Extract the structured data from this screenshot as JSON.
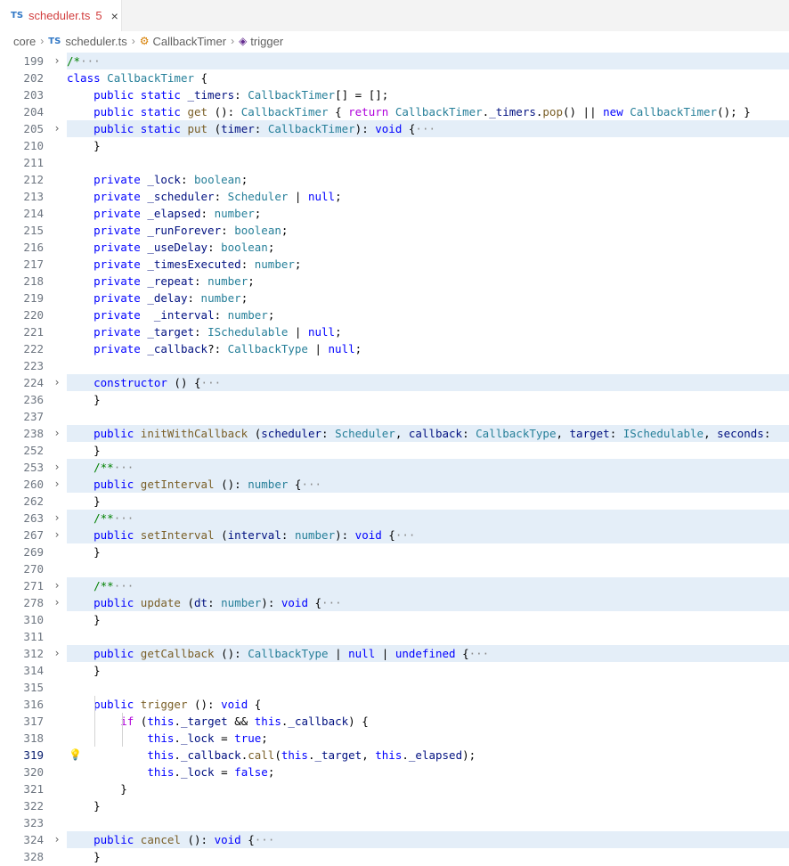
{
  "tab": {
    "icon": "TS",
    "filename": "scheduler.ts",
    "problems": "5",
    "close": "×"
  },
  "breadcrumb": {
    "folder": "core",
    "file_icon": "TS",
    "file": "scheduler.ts",
    "class_name": "CallbackTimer",
    "method": "trigger"
  },
  "lines": [
    {
      "n": "199",
      "fold": true,
      "hl": true,
      "tokens": [
        [
          "cm",
          "/*"
        ],
        [
          "dots",
          "···"
        ]
      ]
    },
    {
      "n": "202",
      "tokens": [
        [
          "kw",
          "class"
        ],
        [
          "",
          " "
        ],
        [
          "ty",
          "CallbackTimer"
        ],
        [
          "",
          " {"
        ]
      ]
    },
    {
      "n": "203",
      "tokens": [
        [
          "",
          "    "
        ],
        [
          "kw",
          "public"
        ],
        [
          "",
          " "
        ],
        [
          "kw",
          "static"
        ],
        [
          "",
          " "
        ],
        [
          "pa",
          "_timers"
        ],
        [
          "",
          ": "
        ],
        [
          "ty",
          "CallbackTimer"
        ],
        [
          "",
          "[] = [];"
        ]
      ]
    },
    {
      "n": "204",
      "tokens": [
        [
          "",
          "    "
        ],
        [
          "kw",
          "public"
        ],
        [
          "",
          " "
        ],
        [
          "kw",
          "static"
        ],
        [
          "",
          " "
        ],
        [
          "fn",
          "get"
        ],
        [
          "",
          " (): "
        ],
        [
          "ty",
          "CallbackTimer"
        ],
        [
          "",
          " { "
        ],
        [
          "ctl",
          "return"
        ],
        [
          "",
          " "
        ],
        [
          "ty",
          "CallbackTimer"
        ],
        [
          "",
          "."
        ],
        [
          "pa",
          "_timers"
        ],
        [
          "",
          "."
        ],
        [
          "fn",
          "pop"
        ],
        [
          "",
          "() || "
        ],
        [
          "kw",
          "new"
        ],
        [
          "",
          " "
        ],
        [
          "ty",
          "CallbackTimer"
        ],
        [
          "",
          "(); }"
        ]
      ]
    },
    {
      "n": "205",
      "fold": true,
      "hl": true,
      "tokens": [
        [
          "",
          "    "
        ],
        [
          "kw",
          "public"
        ],
        [
          "",
          " "
        ],
        [
          "kw",
          "static"
        ],
        [
          "",
          " "
        ],
        [
          "fn",
          "put"
        ],
        [
          "",
          " ("
        ],
        [
          "pa",
          "timer"
        ],
        [
          "",
          ": "
        ],
        [
          "ty",
          "CallbackTimer"
        ],
        [
          "",
          "): "
        ],
        [
          "kw",
          "void"
        ],
        [
          "",
          " {"
        ],
        [
          "dots",
          "···"
        ]
      ]
    },
    {
      "n": "210",
      "tokens": [
        [
          "",
          "    }"
        ]
      ]
    },
    {
      "n": "211",
      "tokens": []
    },
    {
      "n": "212",
      "tokens": [
        [
          "",
          "    "
        ],
        [
          "kw",
          "private"
        ],
        [
          "",
          " "
        ],
        [
          "pa",
          "_lock"
        ],
        [
          "",
          ": "
        ],
        [
          "ty",
          "boolean"
        ],
        [
          "",
          ";"
        ]
      ]
    },
    {
      "n": "213",
      "tokens": [
        [
          "",
          "    "
        ],
        [
          "kw",
          "private"
        ],
        [
          "",
          " "
        ],
        [
          "pa",
          "_scheduler"
        ],
        [
          "",
          ": "
        ],
        [
          "ty",
          "Scheduler"
        ],
        [
          "",
          " | "
        ],
        [
          "kw",
          "null"
        ],
        [
          "",
          ";"
        ]
      ]
    },
    {
      "n": "214",
      "tokens": [
        [
          "",
          "    "
        ],
        [
          "kw",
          "private"
        ],
        [
          "",
          " "
        ],
        [
          "pa",
          "_elapsed"
        ],
        [
          "",
          ": "
        ],
        [
          "ty",
          "number"
        ],
        [
          "",
          ";"
        ]
      ]
    },
    {
      "n": "215",
      "tokens": [
        [
          "",
          "    "
        ],
        [
          "kw",
          "private"
        ],
        [
          "",
          " "
        ],
        [
          "pa",
          "_runForever"
        ],
        [
          "",
          ": "
        ],
        [
          "ty",
          "boolean"
        ],
        [
          "",
          ";"
        ]
      ]
    },
    {
      "n": "216",
      "tokens": [
        [
          "",
          "    "
        ],
        [
          "kw",
          "private"
        ],
        [
          "",
          " "
        ],
        [
          "pa",
          "_useDelay"
        ],
        [
          "",
          ": "
        ],
        [
          "ty",
          "boolean"
        ],
        [
          "",
          ";"
        ]
      ]
    },
    {
      "n": "217",
      "tokens": [
        [
          "",
          "    "
        ],
        [
          "kw",
          "private"
        ],
        [
          "",
          " "
        ],
        [
          "pa",
          "_timesExecuted"
        ],
        [
          "",
          ": "
        ],
        [
          "ty",
          "number"
        ],
        [
          "",
          ";"
        ]
      ]
    },
    {
      "n": "218",
      "tokens": [
        [
          "",
          "    "
        ],
        [
          "kw",
          "private"
        ],
        [
          "",
          " "
        ],
        [
          "pa",
          "_repeat"
        ],
        [
          "",
          ": "
        ],
        [
          "ty",
          "number"
        ],
        [
          "",
          ";"
        ]
      ]
    },
    {
      "n": "219",
      "tokens": [
        [
          "",
          "    "
        ],
        [
          "kw",
          "private"
        ],
        [
          "",
          " "
        ],
        [
          "pa",
          "_delay"
        ],
        [
          "",
          ": "
        ],
        [
          "ty",
          "number"
        ],
        [
          "",
          ";"
        ]
      ]
    },
    {
      "n": "220",
      "tokens": [
        [
          "",
          "    "
        ],
        [
          "kw",
          "private"
        ],
        [
          "",
          "  "
        ],
        [
          "pa",
          "_interval"
        ],
        [
          "",
          ": "
        ],
        [
          "ty",
          "number"
        ],
        [
          "",
          ";"
        ]
      ]
    },
    {
      "n": "221",
      "tokens": [
        [
          "",
          "    "
        ],
        [
          "kw",
          "private"
        ],
        [
          "",
          " "
        ],
        [
          "pa",
          "_target"
        ],
        [
          "",
          ": "
        ],
        [
          "ty",
          "ISchedulable"
        ],
        [
          "",
          " | "
        ],
        [
          "kw",
          "null"
        ],
        [
          "",
          ";"
        ]
      ]
    },
    {
      "n": "222",
      "tokens": [
        [
          "",
          "    "
        ],
        [
          "kw",
          "private"
        ],
        [
          "",
          " "
        ],
        [
          "pa",
          "_callback"
        ],
        [
          "",
          "?: "
        ],
        [
          "ty",
          "CallbackType"
        ],
        [
          "",
          " | "
        ],
        [
          "kw",
          "null"
        ],
        [
          "",
          ";"
        ]
      ]
    },
    {
      "n": "223",
      "tokens": []
    },
    {
      "n": "224",
      "fold": true,
      "hl": true,
      "tokens": [
        [
          "",
          "    "
        ],
        [
          "kw",
          "constructor"
        ],
        [
          "",
          " () {"
        ],
        [
          "dots",
          "···"
        ]
      ]
    },
    {
      "n": "236",
      "tokens": [
        [
          "",
          "    }"
        ]
      ]
    },
    {
      "n": "237",
      "tokens": []
    },
    {
      "n": "238",
      "fold": true,
      "hl": true,
      "tokens": [
        [
          "",
          "    "
        ],
        [
          "kw",
          "public"
        ],
        [
          "",
          " "
        ],
        [
          "fn",
          "initWithCallback"
        ],
        [
          "",
          " ("
        ],
        [
          "pa",
          "scheduler"
        ],
        [
          "",
          ": "
        ],
        [
          "ty",
          "Scheduler"
        ],
        [
          "",
          ", "
        ],
        [
          "pa",
          "callback"
        ],
        [
          "",
          ": "
        ],
        [
          "ty",
          "CallbackType"
        ],
        [
          "",
          ", "
        ],
        [
          "pa",
          "target"
        ],
        [
          "",
          ": "
        ],
        [
          "ty",
          "ISchedulable"
        ],
        [
          "",
          ", "
        ],
        [
          "pa",
          "seconds"
        ],
        [
          "",
          ":"
        ]
      ]
    },
    {
      "n": "252",
      "tokens": [
        [
          "",
          "    }"
        ]
      ]
    },
    {
      "n": "253",
      "fold": true,
      "hl": true,
      "tokens": [
        [
          "",
          "    "
        ],
        [
          "cm",
          "/**"
        ],
        [
          "dots",
          "···"
        ]
      ]
    },
    {
      "n": "260",
      "fold": true,
      "hl": true,
      "tokens": [
        [
          "",
          "    "
        ],
        [
          "kw",
          "public"
        ],
        [
          "",
          " "
        ],
        [
          "fn",
          "getInterval"
        ],
        [
          "",
          " (): "
        ],
        [
          "ty",
          "number"
        ],
        [
          "",
          " {"
        ],
        [
          "dots",
          "···"
        ]
      ]
    },
    {
      "n": "262",
      "tokens": [
        [
          "",
          "    }"
        ]
      ]
    },
    {
      "n": "263",
      "fold": true,
      "hl": true,
      "tokens": [
        [
          "",
          "    "
        ],
        [
          "cm",
          "/**"
        ],
        [
          "dots",
          "···"
        ]
      ]
    },
    {
      "n": "267",
      "fold": true,
      "hl": true,
      "tokens": [
        [
          "",
          "    "
        ],
        [
          "kw",
          "public"
        ],
        [
          "",
          " "
        ],
        [
          "fn",
          "setInterval"
        ],
        [
          "",
          " ("
        ],
        [
          "pa",
          "interval"
        ],
        [
          "",
          ": "
        ],
        [
          "ty",
          "number"
        ],
        [
          "",
          "): "
        ],
        [
          "kw",
          "void"
        ],
        [
          "",
          " {"
        ],
        [
          "dots",
          "···"
        ]
      ]
    },
    {
      "n": "269",
      "tokens": [
        [
          "",
          "    }"
        ]
      ]
    },
    {
      "n": "270",
      "tokens": []
    },
    {
      "n": "271",
      "fold": true,
      "hl": true,
      "tokens": [
        [
          "",
          "    "
        ],
        [
          "cm",
          "/**"
        ],
        [
          "dots",
          "···"
        ]
      ]
    },
    {
      "n": "278",
      "fold": true,
      "hl": true,
      "tokens": [
        [
          "",
          "    "
        ],
        [
          "kw",
          "public"
        ],
        [
          "",
          " "
        ],
        [
          "fn",
          "update"
        ],
        [
          "",
          " ("
        ],
        [
          "pa",
          "dt"
        ],
        [
          "",
          ": "
        ],
        [
          "ty",
          "number"
        ],
        [
          "",
          "): "
        ],
        [
          "kw",
          "void"
        ],
        [
          "",
          " {"
        ],
        [
          "dots",
          "···"
        ]
      ]
    },
    {
      "n": "310",
      "tokens": [
        [
          "",
          "    }"
        ]
      ]
    },
    {
      "n": "311",
      "tokens": []
    },
    {
      "n": "312",
      "fold": true,
      "hl": true,
      "tokens": [
        [
          "",
          "    "
        ],
        [
          "kw",
          "public"
        ],
        [
          "",
          " "
        ],
        [
          "fn",
          "getCallback"
        ],
        [
          "",
          " (): "
        ],
        [
          "ty",
          "CallbackType"
        ],
        [
          "",
          " | "
        ],
        [
          "kw",
          "null"
        ],
        [
          "",
          " | "
        ],
        [
          "kw",
          "undefined"
        ],
        [
          "",
          " {"
        ],
        [
          "dots",
          "···"
        ]
      ]
    },
    {
      "n": "314",
      "tokens": [
        [
          "",
          "    }"
        ]
      ]
    },
    {
      "n": "315",
      "tokens": []
    },
    {
      "n": "316",
      "tokens": [
        [
          "",
          "    "
        ],
        [
          "kw",
          "public"
        ],
        [
          "",
          " "
        ],
        [
          "fn",
          "trigger"
        ],
        [
          "",
          " (): "
        ],
        [
          "kw",
          "void"
        ],
        [
          "",
          " {"
        ]
      ]
    },
    {
      "n": "317",
      "tokens": [
        [
          "",
          "        "
        ],
        [
          "ctl",
          "if"
        ],
        [
          "",
          " ("
        ],
        [
          "kw",
          "this"
        ],
        [
          "",
          "."
        ],
        [
          "pa",
          "_target"
        ],
        [
          "",
          " && "
        ],
        [
          "kw",
          "this"
        ],
        [
          "",
          "."
        ],
        [
          "pa",
          "_callback"
        ],
        [
          "",
          ") {"
        ]
      ]
    },
    {
      "n": "318",
      "tokens": [
        [
          "",
          "            "
        ],
        [
          "kw",
          "this"
        ],
        [
          "",
          "."
        ],
        [
          "pa",
          "_lock"
        ],
        [
          "",
          " = "
        ],
        [
          "kw",
          "true"
        ],
        [
          "",
          ";"
        ]
      ]
    },
    {
      "n": "319",
      "current": true,
      "bulb": true,
      "tokens": [
        [
          "",
          "            "
        ],
        [
          "kw",
          "this"
        ],
        [
          "",
          "."
        ],
        [
          "pa",
          "_callback"
        ],
        [
          "",
          "."
        ],
        [
          "fn",
          "call"
        ],
        [
          "",
          "("
        ],
        [
          "kw",
          "this"
        ],
        [
          "",
          "."
        ],
        [
          "pa",
          "_target"
        ],
        [
          "",
          ", "
        ],
        [
          "kw",
          "this"
        ],
        [
          "",
          "."
        ],
        [
          "pa",
          "_elapsed"
        ],
        [
          "",
          ");"
        ]
      ]
    },
    {
      "n": "320",
      "tokens": [
        [
          "",
          "            "
        ],
        [
          "kw",
          "this"
        ],
        [
          "",
          "."
        ],
        [
          "pa",
          "_lock"
        ],
        [
          "",
          " = "
        ],
        [
          "kw",
          "false"
        ],
        [
          "",
          ";"
        ]
      ]
    },
    {
      "n": "321",
      "tokens": [
        [
          "",
          "        }"
        ]
      ]
    },
    {
      "n": "322",
      "tokens": [
        [
          "",
          "    }"
        ]
      ]
    },
    {
      "n": "323",
      "tokens": []
    },
    {
      "n": "324",
      "fold": true,
      "hl": true,
      "tokens": [
        [
          "",
          "    "
        ],
        [
          "kw",
          "public"
        ],
        [
          "",
          " "
        ],
        [
          "fn",
          "cancel"
        ],
        [
          "",
          " (): "
        ],
        [
          "kw",
          "void"
        ],
        [
          "",
          " {"
        ],
        [
          "dots",
          "···"
        ]
      ]
    },
    {
      "n": "328",
      "tokens": [
        [
          "",
          "    }"
        ]
      ]
    }
  ],
  "icons": {
    "fold": "chevron-right-icon",
    "bulb": "lightbulb-icon",
    "close": "close-icon"
  }
}
